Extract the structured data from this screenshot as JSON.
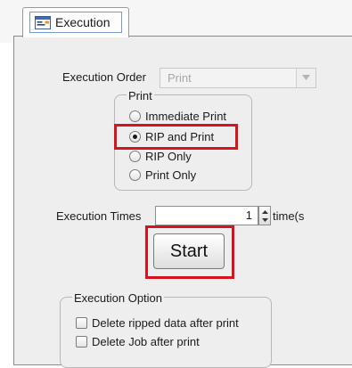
{
  "tab": {
    "label": "Execution",
    "icon": "execution-window-icon"
  },
  "execution_order": {
    "label": "Execution Order",
    "value": "Print",
    "disabled": true
  },
  "print_group": {
    "title": "Print",
    "options": [
      {
        "label": "Immediate Print",
        "checked": false
      },
      {
        "label": "RIP and Print",
        "checked": true
      },
      {
        "label": "RIP Only",
        "checked": false
      },
      {
        "label": "Print Only",
        "checked": false
      }
    ]
  },
  "execution_times": {
    "label": "Execution Times",
    "value": "1",
    "unit": "time(s"
  },
  "start_button": {
    "label": "Start"
  },
  "execution_option": {
    "title": "Execution Option",
    "options": [
      {
        "label": "Delete ripped data after print",
        "checked": false
      },
      {
        "label": "Delete Job after print",
        "checked": false
      }
    ]
  },
  "colors": {
    "highlight": "#d7141e",
    "panel_bg": "#eeeeee",
    "disabled_text": "#a8a8a8"
  }
}
